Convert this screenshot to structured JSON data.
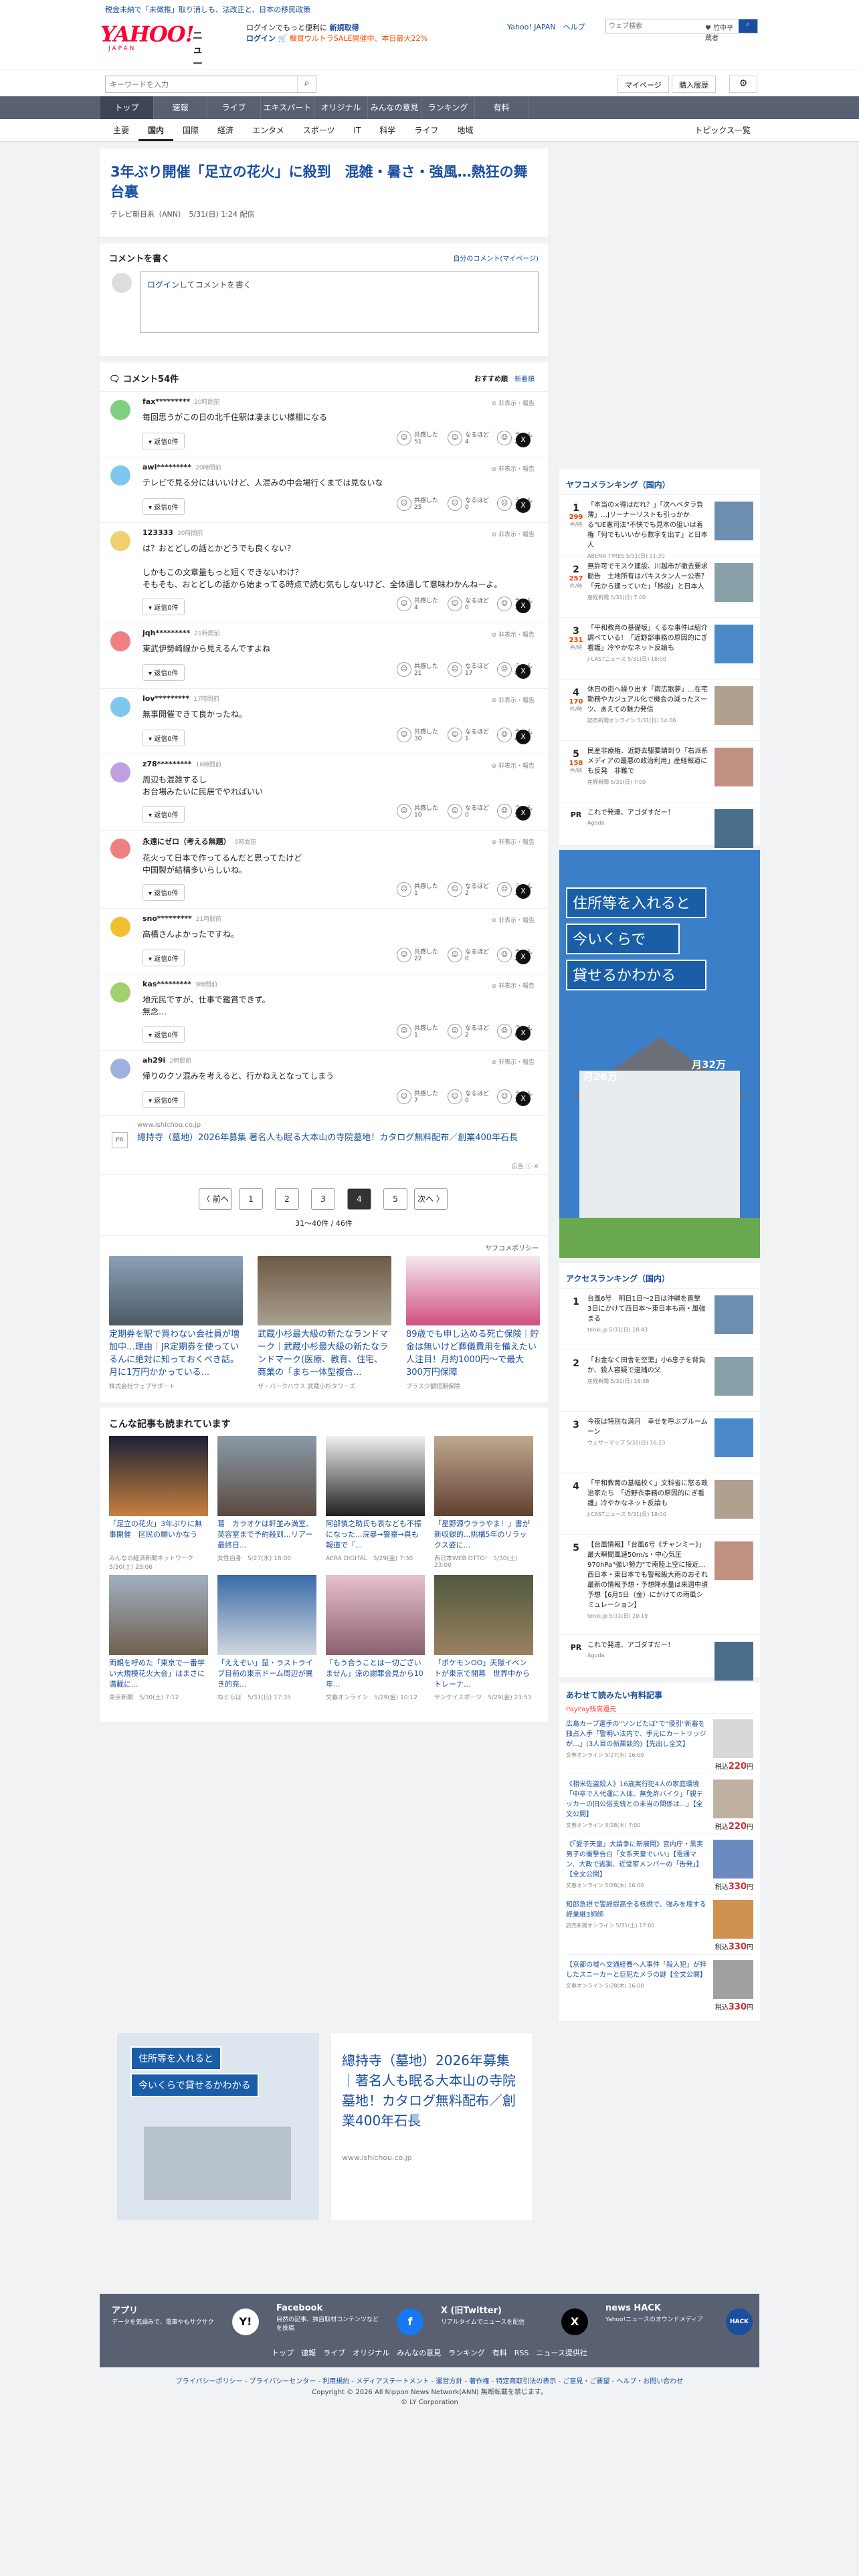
{
  "top_strip": "税金未納で「未徴推」取り消しも、法改正と、日本の移民政策",
  "header": {
    "logo": "YAHOO!",
    "logo_sub": "ニュース",
    "logo_jp": "JAPAN",
    "promo1": "ログインでもっと便利に",
    "promo1b": "新規取得",
    "promo2": "ログイン",
    "promo2b": "🛒 欅買ウルトラSALE開催中、本日最大22%",
    "links": "Yahoo! JAPAN　ヘルプ",
    "web_placeholder": "ウェブ検索",
    "web_engine": "♥ 竹中平蔵者",
    "search_placeholder": "キーワードを入力",
    "mypage": "マイページ",
    "history": "購入履歴"
  },
  "nav1": [
    "トップ",
    "速報",
    "ライブ",
    "エキスパート",
    "オリジナル",
    "みんなの意見",
    "ランキング",
    "有料"
  ],
  "nav2": [
    "主要",
    "国内",
    "国際",
    "経済",
    "エンタメ",
    "スポーツ",
    "IT",
    "科学",
    "ライフ",
    "地域"
  ],
  "nav2_right": "トピックス一覧",
  "article": {
    "title": "3年ぶり開催「足立の花火」に殺到　混雑・暑さ・強風…熱狂の舞台裏",
    "source": "テレビ朝日系（ANN）　5/31(日) 1:24 配信"
  },
  "comment_box": {
    "title": "コメントを書く",
    "mine": "自分のコメント(マイページ)",
    "login": "ログイン",
    "placeholder": "してコメントを書く"
  },
  "comments_head": {
    "count": "コメント54件",
    "sort1": "おすすめ順",
    "sort2": "新着順"
  },
  "comments": [
    {
      "name": "fax*********",
      "time": "20時間前",
      "body": "毎回思うがこの日の北千住駅は凄まじい様相になる",
      "a": "51",
      "b": "4",
      "c": "2",
      "color": "#7ecf7e"
    },
    {
      "name": "awl*********",
      "time": "20時間前",
      "body": "テレビで見る分にはいいけど、人混みの中会場行くまでは見ないな",
      "a": "25",
      "b": "0",
      "c": "3",
      "color": "#7ec8f0"
    },
    {
      "name": "123333",
      "time": "20時間前",
      "body": "は？おとどしの話とかどうでも良くない？\n\nしかもこの文章量もっと短くできないわけ？\nそもそも、おとどしの話から始まってる時点で読む気もしないけど、全体通して意味わかんねーよ。",
      "a": "4",
      "b": "0",
      "c": "12",
      "color": "#f0d070"
    },
    {
      "name": "jqh*********",
      "time": "21時間前",
      "body": "東武伊勢崎線から見えるんですよね",
      "a": "21",
      "b": "17",
      "c": "0",
      "color": "#f08080"
    },
    {
      "name": "lov*********",
      "time": "17時間前",
      "body": "無事開催できて良かったね。",
      "a": "30",
      "b": "1",
      "c": "4",
      "color": "#7ec8f0"
    },
    {
      "name": "z78*********",
      "time": "16時間前",
      "body": "周辺も混雑するし\nお台場みたいに民居でやればいい",
      "a": "10",
      "b": "0",
      "c": "5",
      "color": "#c0a0e0"
    },
    {
      "name": "永遠にゼロ（考える無題）",
      "time": "5時間前",
      "body": "花火って日本で作ってるんだと思ってたけど\n中国製が結構多いらしいね。",
      "a": "1",
      "b": "2",
      "c": "13",
      "color": "#f08080"
    },
    {
      "name": "sno*********",
      "time": "21時間前",
      "body": "高橋さんよかったですね。",
      "a": "22",
      "b": "0",
      "c": "2",
      "color": "#f0c030"
    },
    {
      "name": "kas*********",
      "time": "9時間前",
      "body": "地元民ですが、仕事で鑑賞できず。\n無念…",
      "a": "1",
      "b": "2",
      "c": "6",
      "color": "#a0d070"
    },
    {
      "name": "ah29i",
      "time": "2時間前",
      "body": "帰りのクソ混みを考えると、行かねえとなってしまう",
      "a": "7",
      "b": "0",
      "c": "1",
      "color": "#a0b0e0"
    }
  ],
  "labels": {
    "reply": "返信0件",
    "report": "非表示・報告",
    "kyokan": "共感した",
    "naruhodo": "なるほど",
    "un": "うーん"
  },
  "ad1": {
    "domain": "www.ishichou.co.jp",
    "text": "總持寺（墓地）2026年募集 著名人も眠る大本山の寺院墓地！カタログ無料配布／創業400年石長",
    "tag": "広告 ⓘ ✕"
  },
  "pager": {
    "prev": "〈 前へ",
    "pages": [
      "1",
      "2",
      "3",
      "4",
      "5"
    ],
    "next": "次へ 〉",
    "count": "31〜40件 / 46件"
  },
  "ads3": {
    "policy": "ヤフコメポリシー",
    "items": [
      {
        "t": "定期券を駅で買わない会社員が増加中…理由｜JR定期券を使っているんに絶対に知っておくべき話。月に1万円かかっている...",
        "s": "株式会社ウェブサポート"
      },
      {
        "t": "武蔵小杉最大級の新たなランドマーク｜武蔵小杉最大級の新たなランドマーク(医療、教育、住宅、商業の「まち一体型複合...",
        "s": "ザ・パークハウス 武蔵小杉タワーズ"
      },
      {
        "t": "89歳でも申し込める死亡保険｜貯金は無いけど葬儀費用を備えたい人注目！月約1000円〜で最大300万円保障",
        "s": "プラス少額短期保険"
      }
    ]
  },
  "popular": {
    "title": "こんな記事も読まれています",
    "items": [
      {
        "t": "「足立の花火」3年ぶりに無事開催　区民の願いかなう",
        "s": "みんなの経済新聞ネットワーク　5/30(土) 23:06"
      },
      {
        "t": "葛　カラオケは軒並み満室、英容室まで予約殺到…リアー最終日...",
        "s": "女性自身　5/27(水) 18:00"
      },
      {
        "t": "阿部慎之助氏も表なども不振になった...浣暴→警察→真も報道で「...",
        "s": "AERA DIGITAL　5/29(金) 7:30"
      },
      {
        "t": "「星野源ウララやま！」書が新収録的...挑構5年のリラックス姿に...",
        "s": "西日本WEB OTTO!　5/30(土) 23:00"
      },
      {
        "t": "両親を呼めた「東京で一番学い大規模花火大会」はまさに満載に...",
        "s": "東京新聞　5/30(土) 7:12"
      },
      {
        "t": "「ええぞい」鼠・ラストライブ目前の東京ドーム周辺が異き的充...",
        "s": "ねとらぼ　5/31(日) 17:35"
      },
      {
        "t": "「もう合うことは一切ございません」涼の謝罪会見から10年...",
        "s": "文春オンライン　5/29(金) 10:12"
      },
      {
        "t": "「ポケモンOO」天獄イベントが東京で開幕　世界中からトレーナ...",
        "s": "サンケイスポーツ　5/29(金) 23:53"
      }
    ]
  },
  "bigad": {
    "text": "總持寺（墓地）2026年募集｜著名人も眠る大本山の寺院墓地！カタログ無料配布／創業400年石長",
    "url": "www.ishichou.co.jp",
    "img1": "住所等を入れると",
    "img2": "今いくらで貸せるかわかる"
  },
  "ranking1": {
    "title": "ヤフコメランキング（国内）",
    "items": [
      {
        "n": "1",
        "c": "299",
        "t": "「本当の×得はだれ？」「次ヘベタラ負薄」…Jリーナーリストも引っかかる\"UE憲司法\"不快でも見本の狙いは着権「何でもいいから数字を出す」と日本人",
        "s": "ABEMA TIMES 5/31(日) 11:30"
      },
      {
        "n": "2",
        "c": "257",
        "t": "無許可でモスク建設、川越市が撤去要求勧告　土地所有はパキスタン人ー公表？「元から建っていた」「移設」と日本人",
        "s": "産経新聞 5/31(日) 7:00"
      },
      {
        "n": "3",
        "c": "231",
        "t": "「平和教育の基礎坂」くるな事件は紹介調べている！「近野部事務の原因的にぎ看護」冷やかなネット反論も",
        "s": "J-CASTニュース 5/31(日) 18:00"
      },
      {
        "n": "4",
        "c": "170",
        "t": "休日の街へ繰り出す「雨広歌夢」…在宅勤務やカジュアル化で機会の減ったスーツ、あえての魅力発信",
        "s": "読売新聞オンライン 5/31(日) 14:00"
      },
      {
        "n": "5",
        "c": "158",
        "t": "民産非療権、近野去駆要請到り「右派系メディアの最悪の政治利用」産経報道にも反発　非難で",
        "s": "産経新聞 5/31(日) 7:00"
      }
    ],
    "pr": "これで発達、アゴダすだー！",
    "pr_s": "Agoda"
  },
  "sidead": {
    "l1": "住所等を入れると",
    "l2": "今いくらで",
    "l3": "貸せるかわかる",
    "p1": "月26万",
    "p2": "月32万"
  },
  "ranking2": {
    "title": "アクセスランキング（国内）",
    "items": [
      {
        "n": "1",
        "t": "台風6号　明日1日〜2日は沖縄を直撃　3日にかけて西日本〜東日本も雨・風強まる",
        "s": "tenki.jp 5/31(日) 18:43"
      },
      {
        "n": "2",
        "t": "「お金なく田舎を空蕩」小6息子を背負か、殺人容疑で逮捕の父",
        "s": "産経新聞 5/31(日) 18:38"
      },
      {
        "n": "3",
        "t": "今夜は特別な満月　幸せを呼ぶブルームーン",
        "s": "ウェザーマップ 5/31(日) 16:23"
      },
      {
        "n": "4",
        "t": "「平和教育の基幅校く」文科省に怒る政治家たち　「近野衣事務の原因的にぎ看護」冷やかなネット反論も",
        "s": "J-CASTニュース 5/31(日) 18:00"
      },
      {
        "n": "5",
        "t": "【台風情報】「台風6号《チャンミー》」最大瞬間風速50m/s・中心気圧970hPa\"強い勢力\"で南陸上空に接近…西日本・東日本でも警報級大雨のおそれ　最新の情報予想・予想降水量は来週中頃予想【6月5日（金）にかけての雨風シミュレーション】",
        "s": "tenki.jp 5/31(日) 20:19"
      }
    ],
    "pr": "これで発達、アゴダすだー！",
    "pr_s": "Agoda"
  },
  "sale": {
    "title": "あわせて読みたい有料記事",
    "pp": "PayPay残高還元",
    "items": [
      {
        "t": "広島カープ選手の\"ソンビたぼ\"で\"侵引\"新審を独占入手「警明い法内で、手元にカートリッジが…」(3人目の新薬談的)【先出し全文】",
        "s": "文春オンライン 5/27(水) 16:00",
        "p": "220"
      },
      {
        "t": "《相米佐盗殺人》16歳実行犯4人の家庭環境「中卒で人代運に入体、無免許バイク」「親テッカーの旧公俗支統との未当の関係は...」【全文公開】",
        "s": "文春オンライン 5/28(木) 7:00",
        "p": "220"
      },
      {
        "t": "《「愛子天皇」大論争に新展開》宮内庁・黒実男子の衝撃告白「女系天皇でいい」【電通マン、大政で逃猟、近堂家メンバーの「告発」】【全文公開】",
        "s": "文春オンライン 5/28(木) 16:00",
        "p": "330"
      },
      {
        "t": "知郎急摂で警経提高全る核燃で、強みを埋する経業継3師師",
        "s": "読売新聞オンライン 5/31(土) 17:00",
        "p": "330"
      },
      {
        "t": "【京都の嘘へ交通経費へ人事件「殺人犯」が拝したスニーカーと巨犯たメラの謎【全文公開】",
        "s": "文春オンライン 5/28(木) 16:00",
        "p": "330"
      }
    ]
  },
  "footer": {
    "app_t": "アプリ",
    "app_d": "データを気調みで、電車やもサクサク",
    "fb_t": "Facebook",
    "fb_d": "目然の記事、独自取材コンテンツなどを投稿",
    "x_t": "X (旧Twitter)",
    "x_d": "リアルタイムでニュースを配信",
    "hack_t": "news HACK",
    "hack_d": "Yahoo!ニュースのオウンドメディア",
    "nav": "トップ　速報　ライブ　オリジナル　みんなの意見　ランキング　有料　RSS　ニュース提供社",
    "links": "プライバシーポリシー - プライバシーセンター - 利用規約 - メディアステートメント - 運営方針 - 著作権 - 特定商取引法の表示 - ご意見・ご要望 - ヘルプ・お問い合わせ",
    "copy1": "Copyright © 2026 All Nippon News Network(ANN) 無断転載を禁じます。",
    "copy2": "© LY Corporation"
  }
}
